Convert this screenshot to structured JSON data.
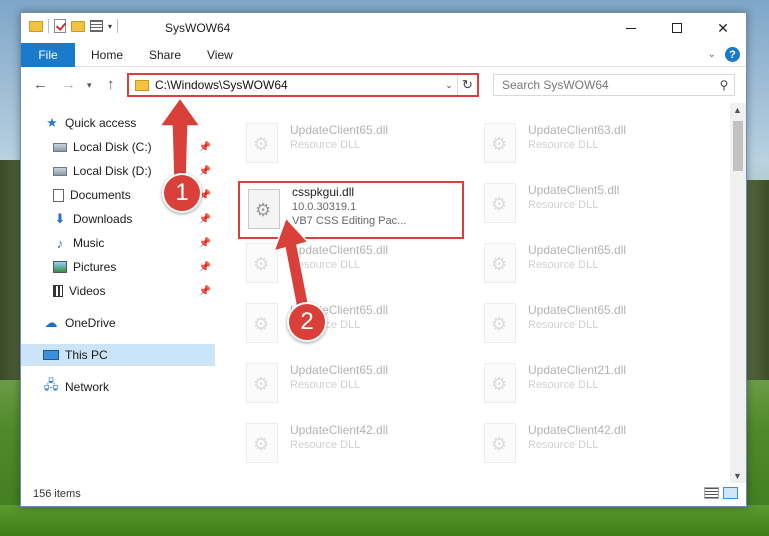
{
  "window": {
    "title": "SysWOW64"
  },
  "ribbon": {
    "file_label": "File",
    "tabs": [
      "Home",
      "Share",
      "View"
    ],
    "help_label": "?"
  },
  "address": {
    "path": "C:\\Windows\\SysWOW64"
  },
  "search": {
    "placeholder": "Search SysWOW64"
  },
  "sidebar": {
    "items": [
      {
        "label": "Quick access",
        "icon": "star-icon"
      },
      {
        "label": "Local Disk (C:)",
        "icon": "disk-icon",
        "pinned": true
      },
      {
        "label": "Local Disk (D:)",
        "icon": "disk-icon",
        "pinned": true
      },
      {
        "label": "Documents",
        "icon": "documents-icon",
        "pinned": true
      },
      {
        "label": "Downloads",
        "icon": "downloads-icon",
        "pinned": true
      },
      {
        "label": "Music",
        "icon": "music-icon",
        "pinned": true
      },
      {
        "label": "Pictures",
        "icon": "pictures-icon",
        "pinned": true
      },
      {
        "label": "Videos",
        "icon": "videos-icon",
        "pinned": true
      },
      {
        "label": "OneDrive",
        "icon": "onedrive-icon"
      },
      {
        "label": "This PC",
        "icon": "pc-icon",
        "selected": true
      },
      {
        "label": "Network",
        "icon": "network-icon"
      }
    ]
  },
  "files": {
    "highlighted": {
      "name": "csspkgui.dll",
      "version": "10.0.30319.1",
      "description": "VB7 CSS Editing Pac..."
    },
    "left": [
      {
        "name": "UpdateClient65.dll",
        "type": "Resource DLL"
      },
      {
        "name": "UpdateClient65.dll",
        "type": "Resource DLL"
      },
      {
        "name": "UpdateClient65.dll",
        "type": "Resource DLL"
      },
      {
        "name": "UpdateClient65.dll",
        "type": "Resource DLL"
      },
      {
        "name": "UpdateClient42.dll",
        "type": "Resource DLL"
      }
    ],
    "right": [
      {
        "name": "UpdateClient63.dll",
        "type": "Resource DLL"
      },
      {
        "name": "UpdateClient5.dll",
        "type": "Resource DLL"
      },
      {
        "name": "UpdateClient65.dll",
        "type": "Resource DLL"
      },
      {
        "name": "UpdateClient65.dll",
        "type": "Resource DLL"
      },
      {
        "name": "UpdateClient21.dll",
        "type": "Resource DLL"
      },
      {
        "name": "UpdateClient42.dll",
        "type": "Resource DLL"
      }
    ]
  },
  "status": {
    "item_count": "156 items"
  },
  "annotations": {
    "badge1": "1",
    "badge2": "2",
    "color": "#d9403a"
  }
}
